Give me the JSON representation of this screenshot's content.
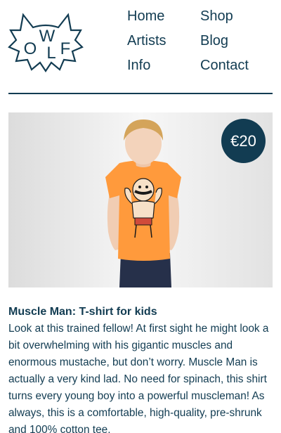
{
  "brand": {
    "logo_letters": [
      "O",
      "W",
      "L",
      "F"
    ]
  },
  "nav": {
    "items": [
      {
        "label": "Home"
      },
      {
        "label": "Shop"
      },
      {
        "label": "Artists"
      },
      {
        "label": "Blog"
      },
      {
        "label": "Info"
      },
      {
        "label": "Contact"
      }
    ]
  },
  "product": {
    "price": "€20",
    "title": "Muscle Man: T-shirt for kids",
    "description": "Look at this trained fellow! At first sight he might look a bit overwhelming with his gigantic muscles and enormous mustache, but don’t worry. Muscle Man is actually a very kind lad. No need for spinach, this shirt turns every young boy into a powerful muscleman! As always, this is a comfortable, high-quality, pre-shrunk and 100% cotton tee."
  },
  "colors": {
    "primary": "#123c52",
    "shirt": "#ff9a3c",
    "background": "#ffffff"
  }
}
